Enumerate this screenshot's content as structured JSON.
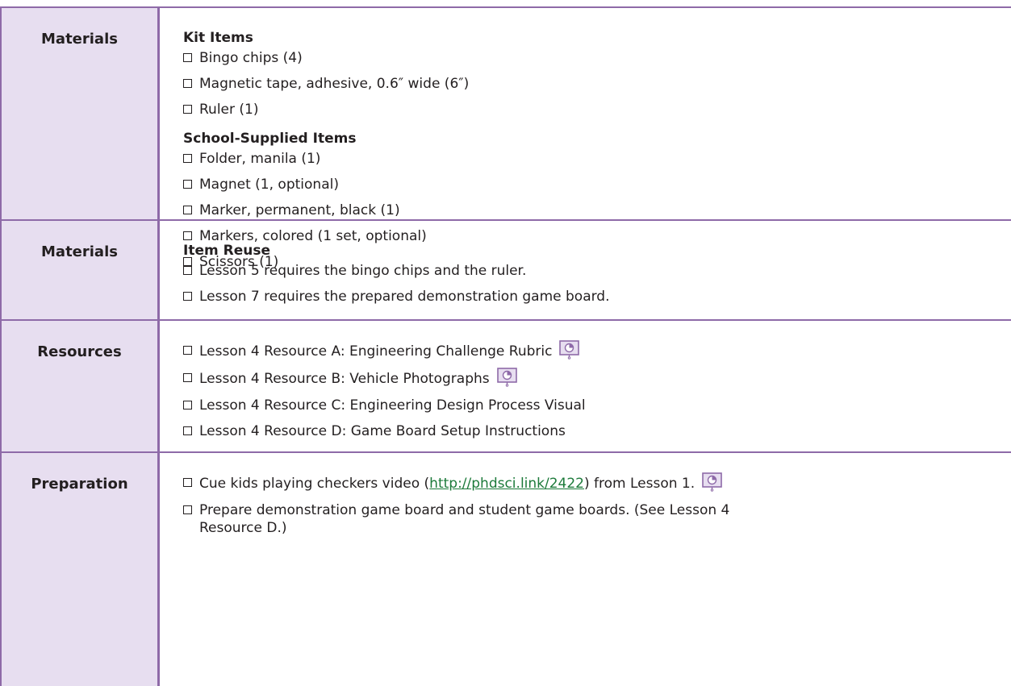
{
  "rows": [
    {
      "label": "Materials",
      "groups": [
        {
          "heading": "Kit Items",
          "items": [
            "Bingo chips (4)",
            "Magnetic tape, adhesive, 0.6″ wide (6″)",
            "Ruler (1)"
          ]
        },
        {
          "heading": "School-Supplied Items",
          "items": [
            "Folder, manila (1)",
            "Magnet (1, optional)",
            "Marker, permanent, black (1)",
            "Markers, colored (1 set, optional)",
            "Scissors (1)"
          ]
        }
      ]
    },
    {
      "label": "Materials",
      "groups": [
        {
          "heading": "Item Reuse",
          "items": [
            "Lesson 5 requires the bingo chips and the ruler.",
            "Lesson 7 requires the prepared demonstration game board."
          ]
        }
      ]
    },
    {
      "label": "Resources",
      "items": [
        {
          "text": "Lesson 4 Resource A: Engineering Challenge Rubric",
          "icon": "slide-icon"
        },
        {
          "text": "Lesson 4 Resource B: Vehicle Photographs",
          "icon": "slide-icon"
        },
        {
          "text": "Lesson 4 Resource C: Engineering Design Process Visual"
        },
        {
          "text": "Lesson 4 Resource D: Game Board Setup Instructions"
        }
      ]
    },
    {
      "label": "Preparation",
      "items": [
        {
          "text_before": "Cue kids playing checkers video (",
          "link": "http://phdsci.link/2422",
          "text_after": ") from Lesson 1.",
          "icon": "slide-icon"
        },
        {
          "text": "Prepare demonstration game board and student game boards. (See Lesson 4\nResource D.)"
        }
      ]
    }
  ],
  "colors": {
    "border": "#8e6aa8",
    "label_bg": "#e7def0",
    "link": "#1c7a3a",
    "icon_fill": "#e7def0"
  }
}
